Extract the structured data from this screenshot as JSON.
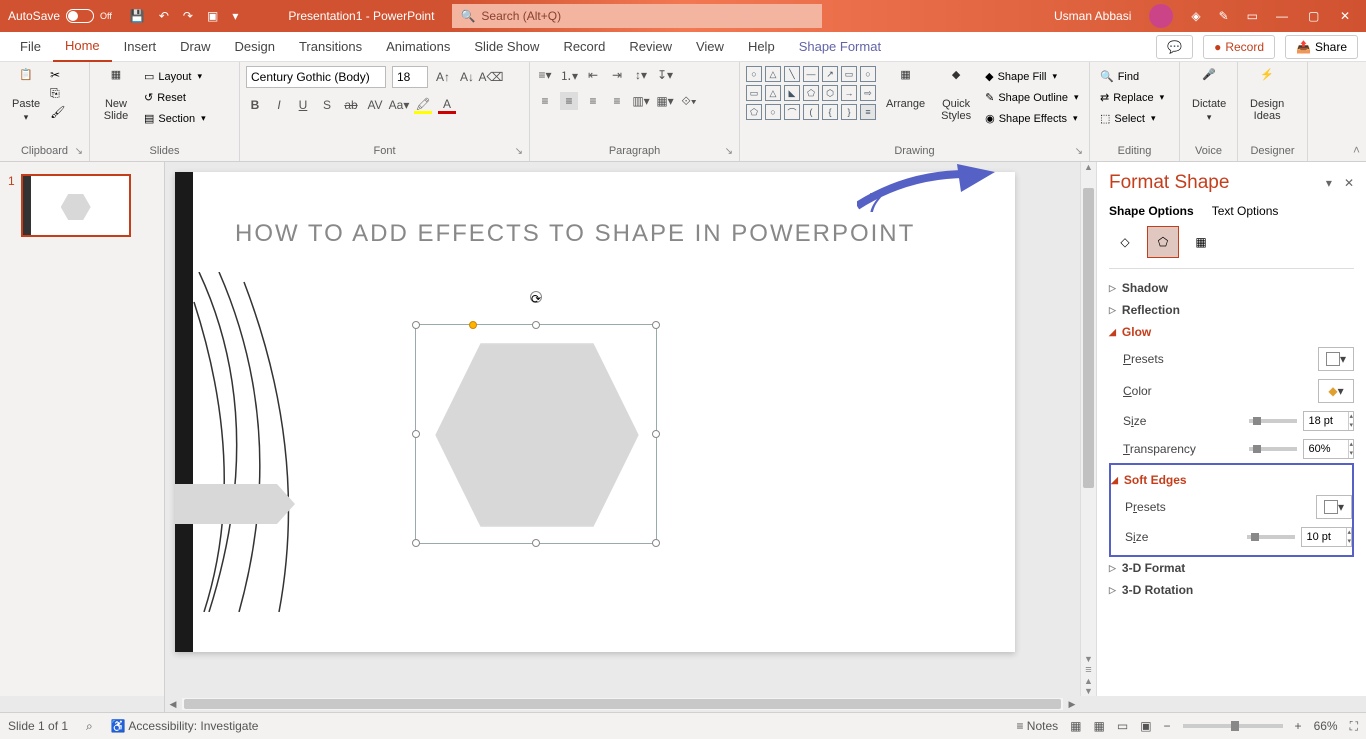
{
  "titlebar": {
    "autosave": "AutoSave",
    "autosave_state": "Off",
    "title": "Presentation1 - PowerPoint",
    "search_placeholder": "Search (Alt+Q)",
    "user": "Usman Abbasi"
  },
  "tabs": {
    "file": "File",
    "home": "Home",
    "insert": "Insert",
    "draw": "Draw",
    "design": "Design",
    "transitions": "Transitions",
    "animations": "Animations",
    "slideshow": "Slide Show",
    "record": "Record",
    "review": "Review",
    "view": "View",
    "help": "Help",
    "shape_format": "Shape Format"
  },
  "tabs_right": {
    "record": "Record",
    "share": "Share"
  },
  "ribbon": {
    "clipboard": {
      "label": "Clipboard",
      "paste": "Paste"
    },
    "slides": {
      "label": "Slides",
      "newslide": "New\nSlide",
      "layout": "Layout",
      "reset": "Reset",
      "section": "Section"
    },
    "font": {
      "label": "Font",
      "face": "Century Gothic (Body)",
      "size": "18"
    },
    "paragraph": {
      "label": "Paragraph"
    },
    "drawing": {
      "label": "Drawing",
      "arrange": "Arrange",
      "quick": "Quick\nStyles",
      "fill": "Shape Fill",
      "outline": "Shape Outline",
      "effects": "Shape Effects"
    },
    "editing": {
      "label": "Editing",
      "find": "Find",
      "replace": "Replace",
      "select": "Select"
    },
    "voice": {
      "label": "Voice",
      "dictate": "Dictate"
    },
    "designer": {
      "label": "Designer",
      "ideas": "Design\nIdeas"
    }
  },
  "thumbs": {
    "num1": "1"
  },
  "slide": {
    "title": "HOW TO ADD EFFECTS TO SHAPE IN POWERPOINT"
  },
  "pane": {
    "title": "Format Shape",
    "tab_shape": "Shape Options",
    "tab_text": "Text Options",
    "shadow": "Shadow",
    "reflection": "Reflection",
    "glow": "Glow",
    "glow_presets": "Presets",
    "glow_color": "Color",
    "glow_size": "Size",
    "glow_size_val": "18 pt",
    "glow_trans": "Transparency",
    "glow_trans_val": "60%",
    "soft": "Soft Edges",
    "soft_presets": "Presets",
    "soft_size": "Size",
    "soft_size_val": "10 pt",
    "format3d": "3-D Format",
    "rotation3d": "3-D Rotation"
  },
  "status": {
    "slide": "Slide 1 of 1",
    "access": "Accessibility: Investigate",
    "notes": "Notes",
    "zoom": "66%"
  }
}
